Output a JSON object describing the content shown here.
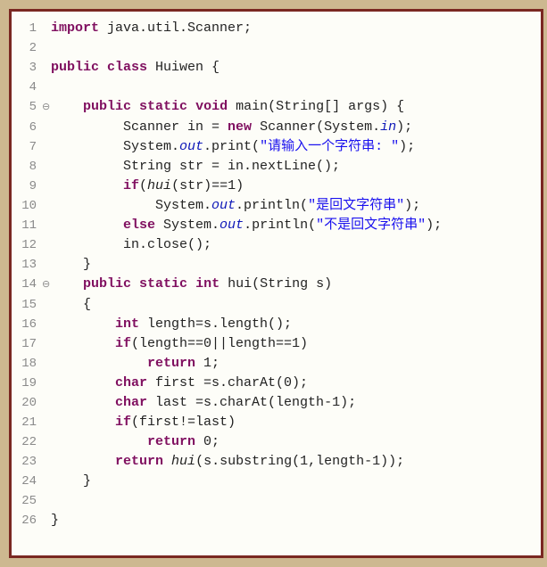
{
  "lines": [
    {
      "n": "1",
      "m": "",
      "segs": [
        [
          "kw",
          "import"
        ],
        [
          "plain",
          " java.util.Scanner;"
        ]
      ]
    },
    {
      "n": "2",
      "m": "",
      "segs": []
    },
    {
      "n": "3",
      "m": "",
      "segs": [
        [
          "kw",
          "public"
        ],
        [
          "plain",
          " "
        ],
        [
          "kw",
          "class"
        ],
        [
          "plain",
          " Huiwen {"
        ]
      ]
    },
    {
      "n": "4",
      "m": "",
      "segs": []
    },
    {
      "n": "5",
      "m": "⊖",
      "segs": [
        [
          "plain",
          "    "
        ],
        [
          "kw",
          "public"
        ],
        [
          "plain",
          " "
        ],
        [
          "kw",
          "static"
        ],
        [
          "plain",
          " "
        ],
        [
          "kw",
          "void"
        ],
        [
          "plain",
          " main(String[] args) {"
        ]
      ]
    },
    {
      "n": "6",
      "m": "",
      "segs": [
        [
          "plain",
          "         Scanner in = "
        ],
        [
          "kw",
          "new"
        ],
        [
          "plain",
          " Scanner(System."
        ],
        [
          "field",
          "in"
        ],
        [
          "plain",
          ");"
        ]
      ]
    },
    {
      "n": "7",
      "m": "",
      "segs": [
        [
          "plain",
          "         System."
        ],
        [
          "field",
          "out"
        ],
        [
          "plain",
          ".print("
        ],
        [
          "str",
          "\"请输入一个字符串: \""
        ],
        [
          "plain",
          ");"
        ]
      ]
    },
    {
      "n": "8",
      "m": "",
      "segs": [
        [
          "plain",
          "         String str = in.nextLine();"
        ]
      ]
    },
    {
      "n": "9",
      "m": "",
      "segs": [
        [
          "plain",
          "         "
        ],
        [
          "kw",
          "if"
        ],
        [
          "plain",
          "("
        ],
        [
          "italic",
          "hui"
        ],
        [
          "plain",
          "(str)==1)"
        ]
      ]
    },
    {
      "n": "10",
      "m": "",
      "segs": [
        [
          "plain",
          "             System."
        ],
        [
          "field",
          "out"
        ],
        [
          "plain",
          ".println("
        ],
        [
          "str",
          "\"是回文字符串\""
        ],
        [
          "plain",
          ");"
        ]
      ]
    },
    {
      "n": "11",
      "m": "",
      "segs": [
        [
          "plain",
          "         "
        ],
        [
          "kw",
          "else"
        ],
        [
          "plain",
          " System."
        ],
        [
          "field",
          "out"
        ],
        [
          "plain",
          ".println("
        ],
        [
          "str",
          "\"不是回文字符串\""
        ],
        [
          "plain",
          ");"
        ]
      ]
    },
    {
      "n": "12",
      "m": "",
      "segs": [
        [
          "plain",
          "         in.close();"
        ]
      ]
    },
    {
      "n": "13",
      "m": "",
      "segs": [
        [
          "plain",
          "    }"
        ]
      ]
    },
    {
      "n": "14",
      "m": "⊖",
      "segs": [
        [
          "plain",
          "    "
        ],
        [
          "kw",
          "public"
        ],
        [
          "plain",
          " "
        ],
        [
          "kw",
          "static"
        ],
        [
          "plain",
          " "
        ],
        [
          "kw",
          "int"
        ],
        [
          "plain",
          " hui(String s)"
        ]
      ]
    },
    {
      "n": "15",
      "m": "",
      "segs": [
        [
          "plain",
          "    {"
        ]
      ]
    },
    {
      "n": "16",
      "m": "",
      "segs": [
        [
          "plain",
          "        "
        ],
        [
          "kw",
          "int"
        ],
        [
          "plain",
          " length=s.length();"
        ]
      ]
    },
    {
      "n": "17",
      "m": "",
      "segs": [
        [
          "plain",
          "        "
        ],
        [
          "kw",
          "if"
        ],
        [
          "plain",
          "(length==0||length==1)"
        ]
      ]
    },
    {
      "n": "18",
      "m": "",
      "segs": [
        [
          "plain",
          "            "
        ],
        [
          "kw",
          "return"
        ],
        [
          "plain",
          " 1;"
        ]
      ]
    },
    {
      "n": "19",
      "m": "",
      "segs": [
        [
          "plain",
          "        "
        ],
        [
          "kw",
          "char"
        ],
        [
          "plain",
          " first =s.charAt(0);"
        ]
      ]
    },
    {
      "n": "20",
      "m": "",
      "segs": [
        [
          "plain",
          "        "
        ],
        [
          "kw",
          "char"
        ],
        [
          "plain",
          " last =s.charAt(length-1);"
        ]
      ]
    },
    {
      "n": "21",
      "m": "",
      "segs": [
        [
          "plain",
          "        "
        ],
        [
          "kw",
          "if"
        ],
        [
          "plain",
          "(first!=last)"
        ]
      ]
    },
    {
      "n": "22",
      "m": "",
      "segs": [
        [
          "plain",
          "            "
        ],
        [
          "kw",
          "return"
        ],
        [
          "plain",
          " 0;"
        ]
      ]
    },
    {
      "n": "23",
      "m": "",
      "segs": [
        [
          "plain",
          "        "
        ],
        [
          "kw",
          "return"
        ],
        [
          "plain",
          " "
        ],
        [
          "italic",
          "hui"
        ],
        [
          "plain",
          "(s.substring(1,length-1));"
        ]
      ]
    },
    {
      "n": "24",
      "m": "",
      "segs": [
        [
          "plain",
          "    }"
        ]
      ]
    },
    {
      "n": "25",
      "m": "",
      "segs": []
    },
    {
      "n": "26",
      "m": "",
      "segs": [
        [
          "plain",
          "}"
        ]
      ]
    }
  ]
}
